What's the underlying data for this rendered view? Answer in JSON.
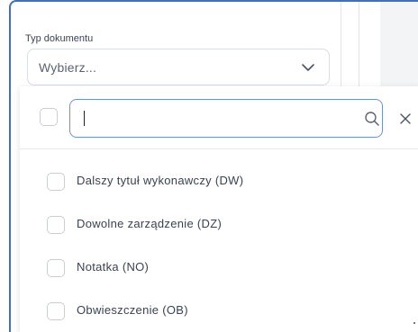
{
  "field": {
    "label": "Typ dokumentu",
    "placeholder": "Wybierz..."
  },
  "dropdown": {
    "search_value": "",
    "items": [
      {
        "label": "Dalszy tytuł wykonawczy (DW)",
        "checked": false
      },
      {
        "label": "Dowolne zarządzenie (DZ)",
        "checked": false
      },
      {
        "label": "Notatka (NO)",
        "checked": false
      },
      {
        "label": "Obwieszczenie (OB)",
        "checked": false
      }
    ]
  },
  "icons": {
    "select": "chevron-down-icon",
    "search": "search-icon",
    "close": "close-icon"
  },
  "colors": {
    "frame_border": "#3f6ec2",
    "search_border": "#6d92cc",
    "text": "#3a4250"
  }
}
